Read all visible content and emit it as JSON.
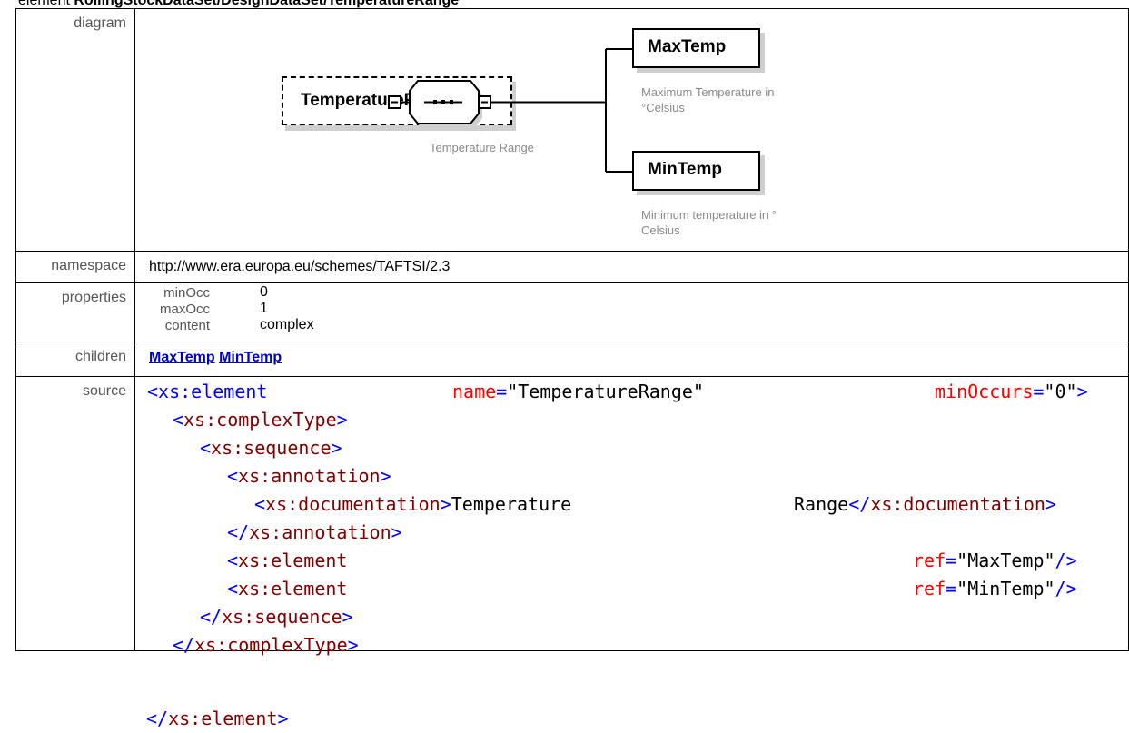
{
  "heading": {
    "prefix": "element ",
    "path": "RollingStockDataSet/DesignDataSet/TemperatureRange"
  },
  "labels": {
    "diagram": "diagram",
    "namespace": "namespace",
    "properties": "properties",
    "children": "children",
    "source": "source"
  },
  "diagram": {
    "root": "TemperatureRange",
    "sequence_doc": "Temperature Range",
    "children": [
      {
        "name": "MaxTemp",
        "doc_line1": "Maximum Temperature in",
        "doc_line2": "°Celsius"
      },
      {
        "name": "MinTemp",
        "doc_line1": "Minimum temperature in °",
        "doc_line2": "Celsius"
      }
    ]
  },
  "namespace": "http://www.era.europa.eu/schemes/TAFTSI/2.3",
  "properties": [
    {
      "key": "minOcc",
      "value": "0"
    },
    {
      "key": "maxOcc",
      "value": "1"
    },
    {
      "key": "content",
      "value": "complex"
    }
  ],
  "children_links": [
    "MaxTemp",
    "MinTemp"
  ],
  "source": {
    "l1_tag": "<xs:element",
    "l1_attr1": "name",
    "l1_val1": "\"TemperatureRange\"",
    "l1_attr2": "minOccurs",
    "l1_val2": "\"0\"",
    "l2": "<xs:complexType>",
    "l3": "<xs:sequence>",
    "l4": "<xs:annotation>",
    "l5_open": "<xs:documentation>",
    "l5_text1": "Temperature",
    "l5_text2": "Range",
    "l5_close": "</xs:documentation>",
    "l6": "</xs:annotation>",
    "l7_tag": "<xs:element",
    "l7_attr": "ref",
    "l7_val": "\"MaxTemp\"",
    "l8_tag": "<xs:element",
    "l8_attr": "ref",
    "l8_val": "\"MinTemp\"",
    "l9": "</xs:sequence>",
    "l10": "</xs:complexType>",
    "l11": "</xs:element>"
  }
}
